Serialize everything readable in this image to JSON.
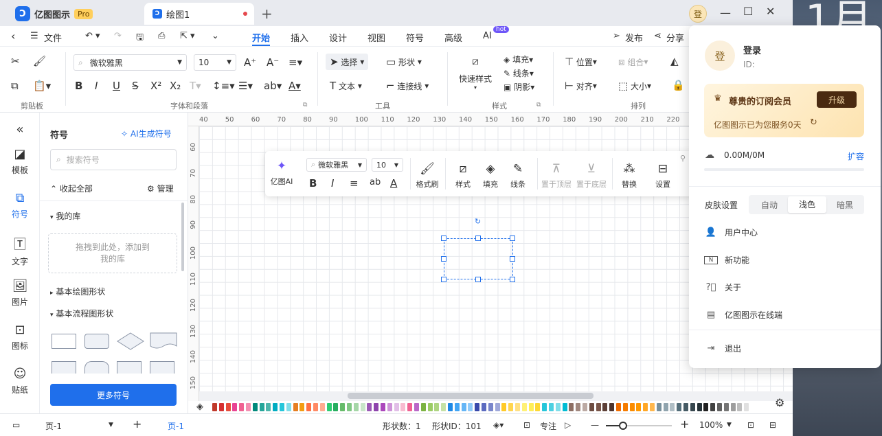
{
  "titlebar": {
    "app_name": "亿图图示",
    "pro_badge": "Pro",
    "doc_tab": "绘图1",
    "avatar_char": "登"
  },
  "menubar": {
    "file": "文件",
    "tabs": [
      "开始",
      "插入",
      "设计",
      "视图",
      "符号",
      "高级",
      "AI"
    ],
    "hot_badge": "hot",
    "publish": "发布",
    "share": "分享"
  },
  "ribbon": {
    "font_name": "微软雅黑",
    "font_size": "10",
    "select": "选择",
    "shape": "形状",
    "text": "文本",
    "connector": "连接线",
    "quick_style": "快速样式",
    "fill": "填充",
    "line": "线条",
    "shadow": "阴影",
    "position": "位置",
    "group": "组合",
    "align": "对齐",
    "size": "大小",
    "group_labels": [
      "剪贴板",
      "字体和段落",
      "工具",
      "样式",
      "排列"
    ]
  },
  "rail": [
    "模板",
    "符号",
    "文字",
    "图片",
    "图标",
    "贴纸"
  ],
  "panel": {
    "title": "符号",
    "ai_gen": "AI生成符号",
    "search_placeholder": "搜索符号",
    "collapse_all": "收起全部",
    "manage": "管理",
    "my_lib": "我的库",
    "drop_hint_1": "拖拽到此处，添加到",
    "drop_hint_2": "我的库",
    "basic_shapes": "基本绘图形状",
    "flow_shapes": "基本流程图形状",
    "more": "更多符号"
  },
  "ruler": {
    "top": [
      "40",
      "50",
      "60",
      "70",
      "80",
      "90",
      "100",
      "110",
      "120",
      "130",
      "140",
      "150",
      "160",
      "170",
      "180",
      "190",
      "200",
      "210",
      "220"
    ],
    "left": [
      "60",
      "70",
      "80",
      "90",
      "100",
      "110",
      "120",
      "130",
      "140",
      "150"
    ]
  },
  "float_toolbar": {
    "ai": "亿图AI",
    "font": "微软雅黑",
    "size": "10",
    "format_brush": "格式刷",
    "style": "样式",
    "fill": "填充",
    "line": "线条",
    "top": "置于顶层",
    "bottom": "置于底层",
    "replace": "替换",
    "settings": "设置"
  },
  "status": {
    "page_sel": "页-1",
    "page_tab": "页-1",
    "shape_count": "形状数：1",
    "shape_id": "形状ID：101",
    "focus": "专注",
    "zoom": "100%"
  },
  "account": {
    "avatar_char": "登",
    "login": "登录",
    "id_label": "ID:",
    "vip_title": "尊贵的订阅会员",
    "upgrade": "升级",
    "served": "亿图图示已为您服务0天",
    "storage": "0.00M/0M",
    "expand": "扩容",
    "skin_label": "皮肤设置",
    "skins": [
      "自动",
      "浅色",
      "暗黑"
    ],
    "user_center": "用户中心",
    "new_features": "新功能",
    "about": "关于",
    "online": "亿图图示在线端",
    "logout": "退出"
  },
  "colors": {
    "accent": "#1f6feb",
    "palette": [
      "#c0392b",
      "#d63031",
      "#e74c3c",
      "#e84393",
      "#f06292",
      "#f48fb1",
      "#00897b",
      "#26a69a",
      "#4db6ac",
      "#00acc1",
      "#26c6da",
      "#80deea",
      "#e67e22",
      "#f39c12",
      "#ff7043",
      "#ff8a65",
      "#ffab91",
      "#2ecc71",
      "#27ae60",
      "#66bb6a",
      "#81c784",
      "#a5d6a7",
      "#c8e6c9",
      "#9b59b6",
      "#8e44ad",
      "#ab47bc",
      "#ce93d8",
      "#e1bee7",
      "#f8bbd0",
      "#f06292",
      "#ba68c8",
      "#7cb342",
      "#9ccc65",
      "#aed581",
      "#c5e1a5",
      "#1e88e5",
      "#42a5f5",
      "#64b5f6",
      "#90caf9",
      "#3949ab",
      "#5c6bc0",
      "#7986cb",
      "#9fa8da",
      "#ffca28",
      "#ffd54f",
      "#ffe082",
      "#fff176",
      "#ffee58",
      "#fdd835",
      "#26c6da",
      "#4dd0e1",
      "#80deea",
      "#00bcd4",
      "#8d6e63",
      "#a1887f",
      "#bcaaa4",
      "#6d4c41",
      "#795548",
      "#5d4037",
      "#4e342e",
      "#ef6c00",
      "#f57c00",
      "#fb8c00",
      "#ff9800",
      "#ffa726",
      "#ffb74d",
      "#78909c",
      "#90a4ae",
      "#b0bec5",
      "#546e7a",
      "#455a64",
      "#37474f",
      "#263238",
      "#212121",
      "#424242",
      "#616161",
      "#757575",
      "#9e9e9e",
      "#bdbdbd",
      "#e0e0e0"
    ]
  }
}
